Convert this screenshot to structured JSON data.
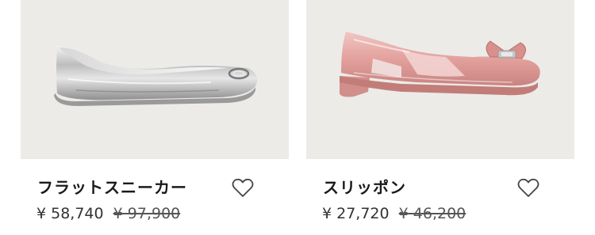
{
  "products": [
    {
      "name": "フラットスニーカー",
      "price": "¥ 58,740",
      "original_price": "¥ 97,900",
      "image": "silver-ballet-flat",
      "favorite_icon": "heart-outline-icon",
      "colors": {
        "shoe": "#c9c9c9",
        "background": "#ecebe8"
      }
    },
    {
      "name": "スリッポン",
      "price": "¥ 27,720",
      "original_price": "¥ 46,200",
      "image": "pink-bow-flat",
      "favorite_icon": "heart-outline-icon",
      "colors": {
        "shoe": "#e4a9a6",
        "background": "#ecebe8"
      }
    }
  ]
}
